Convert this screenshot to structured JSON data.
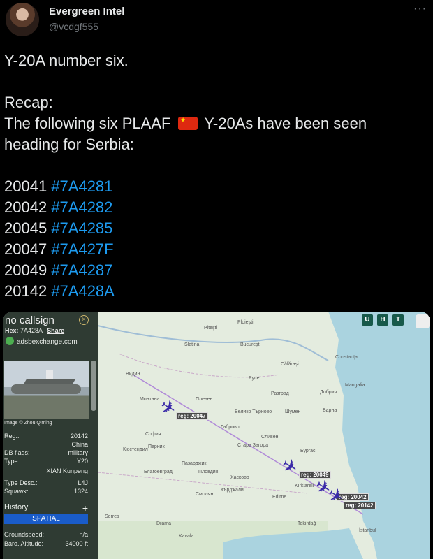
{
  "header": {
    "display_name": "Evergreen Intel",
    "handle": "@vcdgf555",
    "more_icon": "more-icon"
  },
  "tweet": {
    "line1": "Y-20A number six.",
    "recap": "Recap:",
    "line3_a": "The following six PLAAF",
    "line3_b": "Y-20As have been seen",
    "line4": "heading for Serbia:",
    "aircraft": [
      {
        "serial": "20041",
        "hex": "#7A4281"
      },
      {
        "serial": "20042",
        "hex": "#7A4282"
      },
      {
        "serial": "20045",
        "hex": "#7A4285"
      },
      {
        "serial": "20047",
        "hex": "#7A427F"
      },
      {
        "serial": "20049",
        "hex": "#7A4287"
      },
      {
        "serial": "20142",
        "hex": "#7A428A"
      }
    ]
  },
  "panel": {
    "title": "no callsign",
    "close": "×",
    "hex_label": "Hex:",
    "hex_value": "7A428A",
    "share": "Share",
    "site": "adsbexchange.com",
    "credit": "Image © Zhou Qiming",
    "rows": [
      {
        "k": "Reg.:",
        "v": "20142"
      },
      {
        "k": "",
        "v": "China"
      },
      {
        "k": "DB flags:",
        "v": "military"
      },
      {
        "k": "Type:",
        "v": "Y20"
      },
      {
        "k": "",
        "v": "XIAN Kunpeng"
      },
      {
        "k": "Type Desc.:",
        "v": "L4J"
      },
      {
        "k": "Squawk:",
        "v": "1324"
      }
    ],
    "history": "History",
    "plus": "+",
    "spatial": "SPATIAL",
    "rows2": [
      {
        "k": "Groundspeed:",
        "v": "n/a"
      },
      {
        "k": "Baro. Altitude:",
        "v": "34000 ft"
      }
    ]
  },
  "map": {
    "buttons": [
      "U",
      "H",
      "T"
    ],
    "cities": [
      "Ploiești",
      "București",
      "Pitești",
      "Slatina",
      "Călărași",
      "Constanța",
      "Видин",
      "Монтана",
      "Плевен",
      "Русе",
      "Разград",
      "Шумен",
      "Варна",
      "Добрич",
      "Mangalia",
      "Велико Търново",
      "Габрово",
      "София",
      "Перник",
      "Стара Загора",
      "Сливен",
      "Бургас",
      "Пловдив",
      "Хасково",
      "Кърджали",
      "Edirne",
      "Kırklareli",
      "İstanbul",
      "Tekirdağ",
      "Кюстендил",
      "Благоевград",
      "Пазарджик",
      "Смолян",
      "Kavala",
      "Drama",
      "Serres"
    ],
    "regs": [
      "reg: 20047",
      "reg: 20049",
      "reg: 20042",
      "reg: 20142"
    ],
    "plane_icon": "plane-icon"
  },
  "colors": {
    "link": "#1d9bf0",
    "panel": "#2f3b33",
    "plane": "#3a2aa8",
    "track": "#b08ad8"
  }
}
